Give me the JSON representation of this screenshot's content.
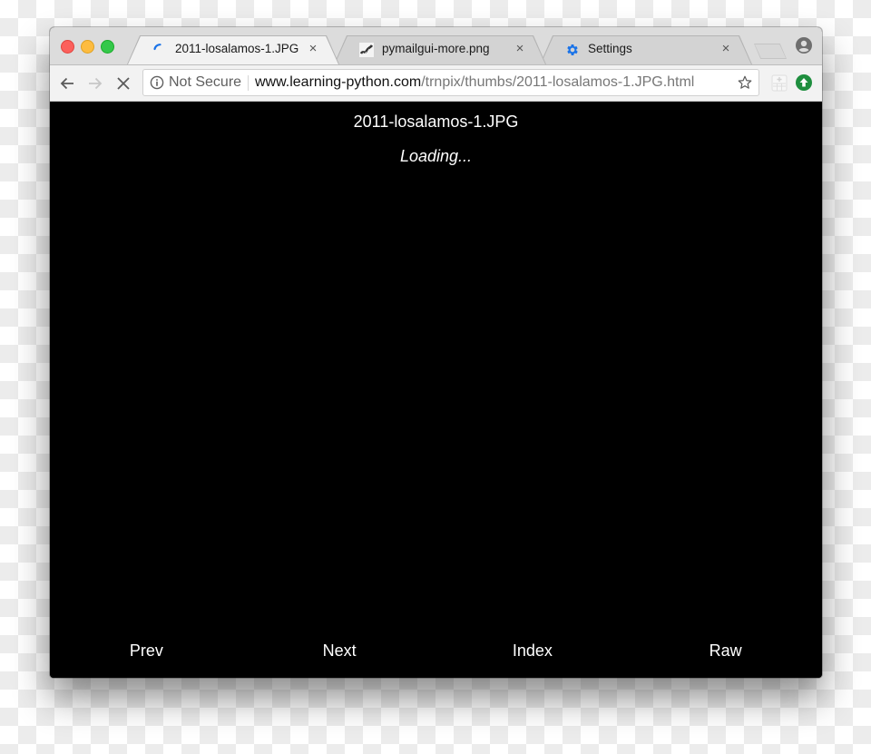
{
  "browser": {
    "tabs": [
      {
        "title": "2011-losalamos-1.JPG",
        "favicon": "loading-spinner-icon",
        "active": true,
        "close": "×"
      },
      {
        "title": "pymailgui-more.png",
        "favicon": "snake-image-icon",
        "active": false,
        "close": "×"
      },
      {
        "title": "Settings",
        "favicon": "gear-icon",
        "active": false,
        "close": "×"
      }
    ],
    "omnibox": {
      "security_label": "Not Secure",
      "url_host": "www.learning-python.com",
      "url_path": "/trnpix/thumbs/2011-losalamos-1.JPG.html"
    },
    "colors": {
      "spinner": "#1a73e8",
      "gear": "#1a73e8",
      "update_badge": "#1e8e3e"
    }
  },
  "page": {
    "title": "2011-losalamos-1.JPG",
    "status": "Loading...",
    "nav_links": [
      {
        "label": "Prev"
      },
      {
        "label": "Next"
      },
      {
        "label": "Index"
      },
      {
        "label": "Raw"
      }
    ]
  }
}
